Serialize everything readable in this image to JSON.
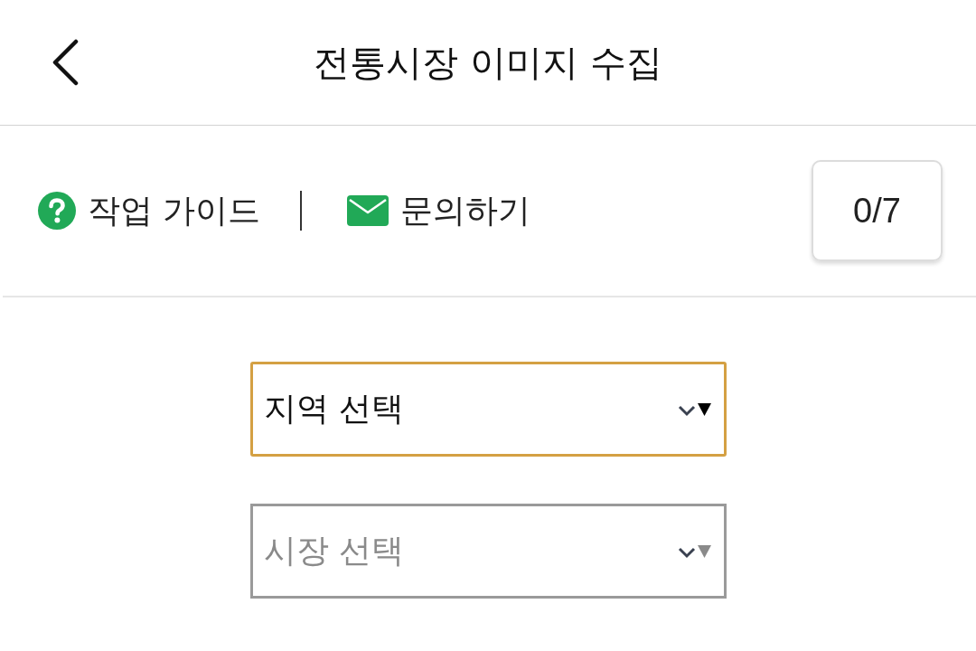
{
  "header": {
    "title": "전통시장 이미지 수집"
  },
  "toolbar": {
    "links": [
      {
        "kind": "guide",
        "label": "작업 가이드"
      },
      {
        "kind": "contact",
        "label": "문의하기"
      }
    ],
    "counter": "0/7"
  },
  "selects": [
    {
      "label": "지역 선택",
      "focused": true,
      "disabled": false
    },
    {
      "label": "시장 선택",
      "focused": false,
      "disabled": true
    }
  ]
}
